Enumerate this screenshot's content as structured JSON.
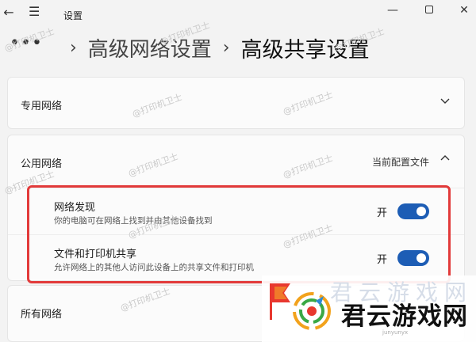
{
  "window": {
    "title": "设置",
    "back_icon": "back-arrow-icon",
    "menu_icon": "hamburger-menu-icon"
  },
  "breadcrumb": {
    "more": "•••",
    "parent": "高级网络设置",
    "current": "高级共享设置"
  },
  "sections": {
    "private": {
      "label": "专用网络",
      "expanded": false
    },
    "public": {
      "label": "公用网络",
      "profile_tag": "当前配置文件",
      "expanded": true,
      "network_discovery": {
        "title": "网络发现",
        "description": "你的电脑可在网络上找到并由其他设备找到",
        "state_label": "开",
        "on": true
      },
      "file_printer_sharing": {
        "title": "文件和打印机共享",
        "description": "允许网络上的其他人访问此设备上的共享文件和打印机",
        "state_label": "开",
        "on": true
      }
    },
    "all": {
      "label": "所有网络",
      "expanded": false
    }
  },
  "watermark": "@打印机卫士",
  "logo": {
    "name": "君云游戏网",
    "domain": "junyunyx"
  },
  "colors": {
    "accent": "#1d5db5",
    "highlight": "#e23a3a",
    "background": "#f3f3f3",
    "card": "#fbfbfb"
  }
}
